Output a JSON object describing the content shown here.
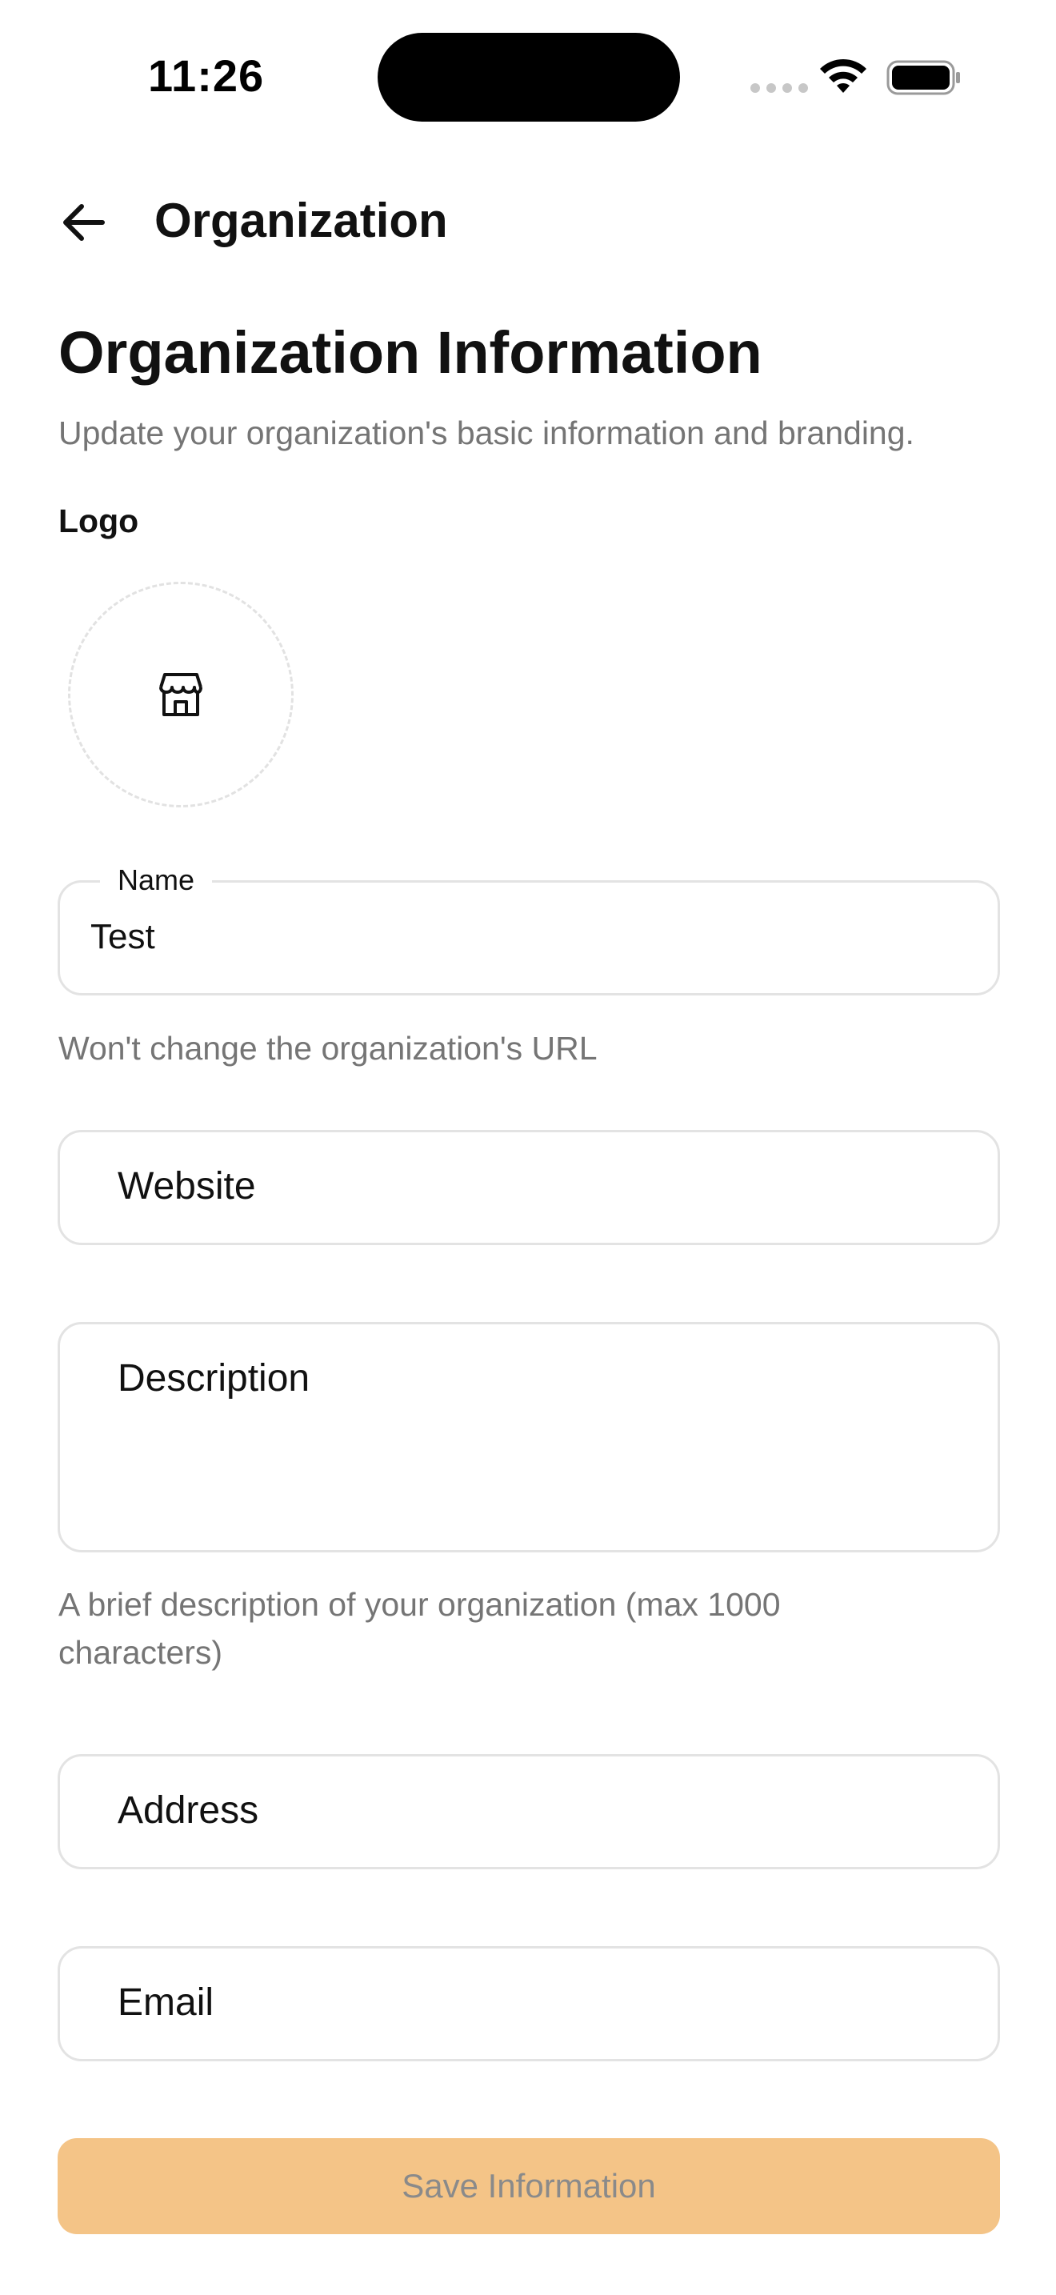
{
  "status_bar": {
    "time": "11:26"
  },
  "header": {
    "back_icon": "arrow-left-icon",
    "title": "Organization"
  },
  "section": {
    "title": "Organization Information",
    "subtitle": "Update your organization's basic information and branding."
  },
  "logo": {
    "label": "Logo",
    "icon": "store-icon"
  },
  "fields": {
    "name": {
      "label": "Name",
      "value": "Test",
      "helper": "Won't change the organization's URL"
    },
    "website": {
      "placeholder": "Website"
    },
    "description": {
      "placeholder": "Description",
      "helper": "A brief description of your organization (max 1000 characters)"
    },
    "address": {
      "placeholder": "Address"
    },
    "email": {
      "placeholder": "Email"
    }
  },
  "actions": {
    "save_label": "Save Information"
  },
  "colors": {
    "accent": "#f4c487",
    "muted_text": "#757575",
    "border": "#e3e3e3"
  }
}
